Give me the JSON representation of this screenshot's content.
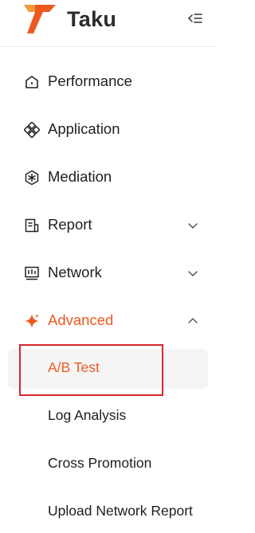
{
  "brand": {
    "name": "Taku",
    "accent": "#ec5a22"
  },
  "header": {
    "collapse_icon": "menu-collapse-icon"
  },
  "nav": {
    "items": [
      {
        "label": "Performance",
        "icon": "home-icon"
      },
      {
        "label": "Application",
        "icon": "app-grid-icon"
      },
      {
        "label": "Mediation",
        "icon": "hexagon-icon"
      },
      {
        "label": "Report",
        "icon": "report-icon",
        "expanded": false
      },
      {
        "label": "Network",
        "icon": "network-icon",
        "expanded": false
      },
      {
        "label": "Advanced",
        "icon": "sparkle-icon",
        "expanded": true,
        "active": true
      }
    ],
    "sub_items": [
      {
        "label": "A/B Test",
        "selected": true
      },
      {
        "label": "Log Analysis"
      },
      {
        "label": "Cross Promotion"
      },
      {
        "label": "Upload Network Report"
      }
    ]
  },
  "highlight_color": "#d9262d"
}
